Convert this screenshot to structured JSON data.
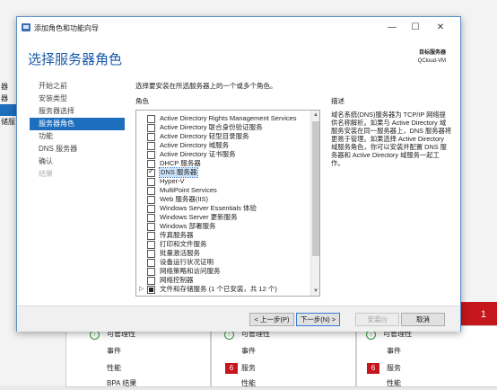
{
  "background": {
    "left_nav": [
      "器",
      "器",
      "",
      "储服"
    ],
    "red_badge": "1",
    "tiles": [
      {
        "manageable": "可管理性",
        "events": "事件",
        "perf": "性能",
        "extra": "BPA 结果"
      },
      {
        "manageable": "可管理性",
        "events": "事件",
        "badge": "6",
        "services": "服务",
        "perf": "性能"
      },
      {
        "manageable": "可管理性",
        "events": "事件",
        "badge": "6",
        "services": "服务",
        "perf": "性能"
      }
    ]
  },
  "dialog": {
    "title": "添加角色和功能向导",
    "controls": {
      "minimize": "—",
      "maximize": "☐",
      "close": "✕"
    },
    "heading": "选择服务器角色",
    "destination_label": "目标服务器",
    "destination_value": "QCloud-VM",
    "steps": [
      {
        "label": "开始之前",
        "state": "normal"
      },
      {
        "label": "安装类型",
        "state": "normal"
      },
      {
        "label": "服务器选择",
        "state": "normal"
      },
      {
        "label": "服务器角色",
        "state": "active"
      },
      {
        "label": "功能",
        "state": "normal"
      },
      {
        "label": "DNS 服务器",
        "state": "normal"
      },
      {
        "label": "确认",
        "state": "normal"
      },
      {
        "label": "结果",
        "state": "disabled"
      }
    ],
    "instruction": "选择要安装在所选服务器上的一个或多个角色。",
    "roles_header": "角色",
    "description_header": "描述",
    "roles": [
      {
        "label": "Active Directory Rights Management Services",
        "state": "unchecked"
      },
      {
        "label": "Active Directory 联合身份验证服务",
        "state": "unchecked"
      },
      {
        "label": "Active Directory 轻型目录服务",
        "state": "unchecked"
      },
      {
        "label": "Active Directory 域服务",
        "state": "unchecked"
      },
      {
        "label": "Active Directory 证书服务",
        "state": "unchecked"
      },
      {
        "label": "DHCP 服务器",
        "state": "unchecked"
      },
      {
        "label": "DNS 服务器",
        "state": "checked",
        "selected": true
      },
      {
        "label": "Hyper-V",
        "state": "unchecked"
      },
      {
        "label": "MultiPoint Services",
        "state": "unchecked"
      },
      {
        "label": "Web 服务器(IIS)",
        "state": "unchecked"
      },
      {
        "label": "Windows Server Essentials 体验",
        "state": "unchecked"
      },
      {
        "label": "Windows Server 更新服务",
        "state": "unchecked"
      },
      {
        "label": "Windows 部署服务",
        "state": "unchecked"
      },
      {
        "label": "传真服务器",
        "state": "unchecked"
      },
      {
        "label": "打印和文件服务",
        "state": "unchecked"
      },
      {
        "label": "批量激活服务",
        "state": "unchecked"
      },
      {
        "label": "设备运行状况证明",
        "state": "unchecked"
      },
      {
        "label": "网络策略和访问服务",
        "state": "unchecked"
      },
      {
        "label": "网络控制器",
        "state": "unchecked"
      },
      {
        "label": "文件和存储服务 (1 个已安装，共 12 个)",
        "state": "partial",
        "expandable": true
      }
    ],
    "description": "域名系统(DNS)服务器为 TCP/IP 网络提供名称解析。如果与 Active Directory 域服务安装在同一服务器上，DNS 服务器将更易于管理。如果选择 Active Directory 域服务角色，你可以安装并配置 DNS 服务器和 Active Directory 域服务一起工作。",
    "buttons": {
      "previous": "< 上一步(P)",
      "next": "下一步(N) >",
      "install": "安装(I)",
      "cancel": "取消"
    }
  }
}
